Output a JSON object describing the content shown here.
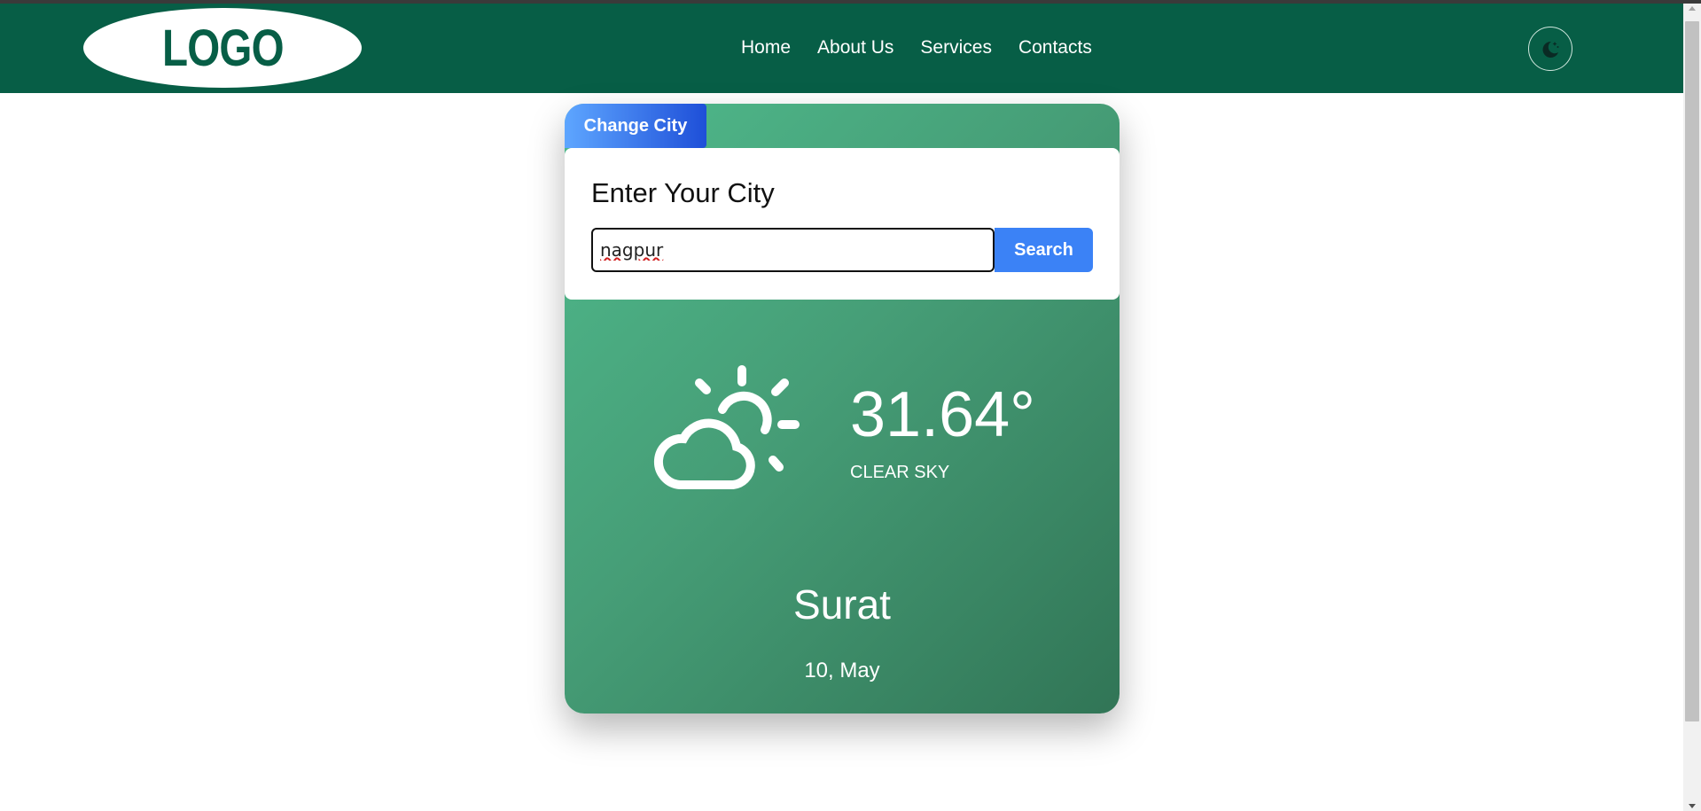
{
  "brand": {
    "logo_text": "LOGO"
  },
  "nav": {
    "links": [
      "Home",
      "About Us",
      "Services",
      "Contacts"
    ]
  },
  "theme_toggle": {
    "icon": "moon-stars-icon"
  },
  "weather_card": {
    "change_city_label": "Change City",
    "search": {
      "title": "Enter Your City",
      "input_value": "nagpur",
      "button_label": "Search"
    },
    "icon": "partly-cloudy-sun-icon",
    "temperature": "31.64°",
    "condition": "CLEAR SKY",
    "city": "Surat",
    "date": "10, May"
  },
  "colors": {
    "navbar": "#075e46",
    "card_gradient_start": "#4fba8c",
    "card_gradient_end": "#317556",
    "search_button": "#3b82f6",
    "tab_gradient_start": "#5ea6ff",
    "tab_gradient_end": "#1e4fd8"
  }
}
